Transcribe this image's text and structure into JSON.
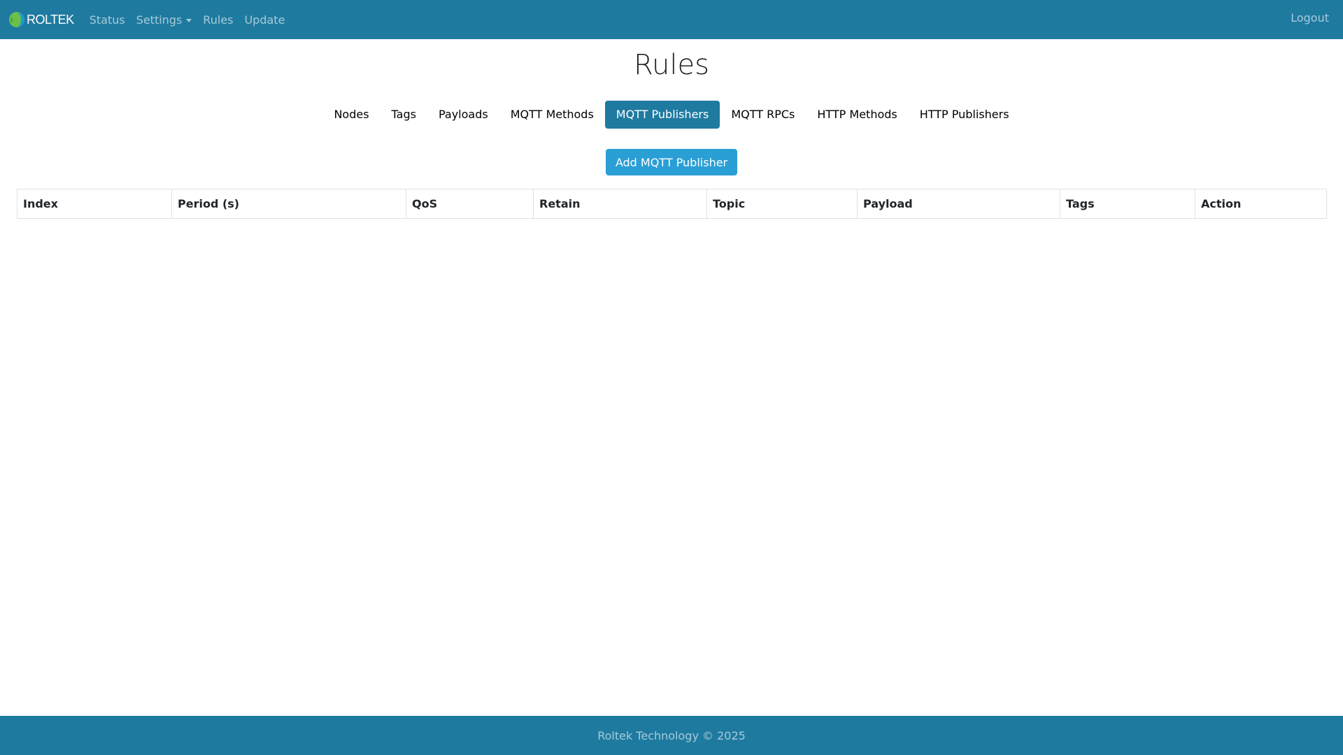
{
  "navbar": {
    "brand": "ROLTEK",
    "links": [
      {
        "label": "Status"
      },
      {
        "label": "Settings"
      },
      {
        "label": "Rules"
      },
      {
        "label": "Update"
      }
    ],
    "logout_label": "Logout",
    "bg_color": "#1f7aa0"
  },
  "page": {
    "title": "Rules"
  },
  "tabs": [
    {
      "label": "Nodes",
      "active": false
    },
    {
      "label": "Tags",
      "active": false
    },
    {
      "label": "Payloads",
      "active": false
    },
    {
      "label": "MQTT Methods",
      "active": false
    },
    {
      "label": "MQTT Publishers",
      "active": true
    },
    {
      "label": "MQTT RPCs",
      "active": false
    },
    {
      "label": "HTTP Methods",
      "active": false
    },
    {
      "label": "HTTP Publishers",
      "active": false
    }
  ],
  "add_button_label": "Add MQTT Publisher",
  "table": {
    "columns": [
      "Index",
      "Period (s)",
      "QoS",
      "Retain",
      "Topic",
      "Payload",
      "Tags",
      "Action"
    ],
    "rows": []
  },
  "footer": {
    "text": "Roltek Technology © 2025"
  },
  "colors": {
    "primary": "#1f7aa0",
    "button": "#2a9fd6"
  }
}
